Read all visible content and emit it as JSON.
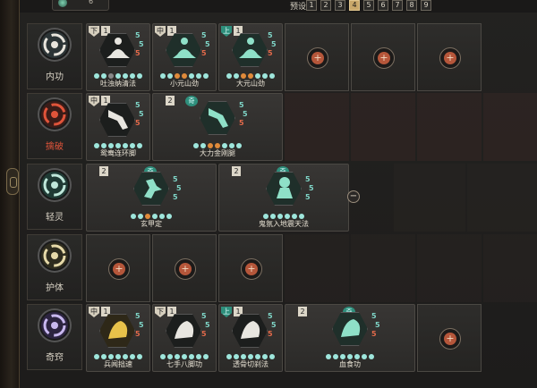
{
  "top": {
    "slot_count": "6",
    "preset_label": "预设",
    "presets": [
      "1",
      "2",
      "3",
      "4",
      "5",
      "6",
      "7",
      "8",
      "9"
    ],
    "active_preset": "4"
  },
  "categories": [
    {
      "label": "内功",
      "color": "#d6d1c6"
    },
    {
      "label": "擒破",
      "color": "#d9532f"
    },
    {
      "label": "轻灵",
      "color": "#d6d1c6"
    },
    {
      "label": "护体",
      "color": "#d6d1c6"
    },
    {
      "label": "奇窍",
      "color": "#d6d1c6"
    }
  ],
  "rows": [
    {
      "cards": [
        {
          "name": "吐浊纳清法",
          "tier": "下",
          "count": "1",
          "stats": [
            "5",
            "5",
            "5"
          ]
        },
        {
          "name": "小元山劲",
          "tier": "中",
          "count": "1",
          "stats": [
            "5",
            "5",
            "5"
          ]
        },
        {
          "name": "大元山劲",
          "tier": "上",
          "count": "1",
          "stats": [
            "5",
            "5",
            "5"
          ]
        }
      ],
      "add_label": "+"
    },
    {
      "cards": [
        {
          "name": "鸳鸯连环脚",
          "tier": "中",
          "count": "1",
          "stats": [
            "5",
            "5",
            "5"
          ]
        },
        {
          "name": "大力金刚腿",
          "tier": "",
          "count": "2",
          "badge": "奇",
          "stats": [
            "5",
            "5",
            "5"
          ]
        }
      ]
    },
    {
      "cards": [
        {
          "name": "玄甲定",
          "count": "2",
          "badge": "奇",
          "stats": [
            "5",
            "5",
            "5"
          ]
        },
        {
          "name": "鬼氛入地震天法",
          "count": "2",
          "badge": "奇",
          "stats": [
            "5",
            "5",
            "5"
          ]
        }
      ],
      "minus_label": "−"
    },
    {
      "add_label": "+"
    },
    {
      "cards": [
        {
          "name": "兵闻拙速",
          "tier": "中",
          "count": "1",
          "stats": [
            "5",
            "5",
            "5"
          ]
        },
        {
          "name": "七手八脚功",
          "tier": "下",
          "count": "1",
          "stats": [
            "5",
            "5",
            "5"
          ]
        },
        {
          "name": "透骨切刹法",
          "tier": "上",
          "count": "1",
          "stats": [
            "5",
            "5",
            "5"
          ]
        },
        {
          "name": "血食功",
          "count": "2",
          "badge": "奇",
          "stats": [
            "5",
            "5",
            "5"
          ]
        }
      ],
      "add_label": "+"
    }
  ]
}
